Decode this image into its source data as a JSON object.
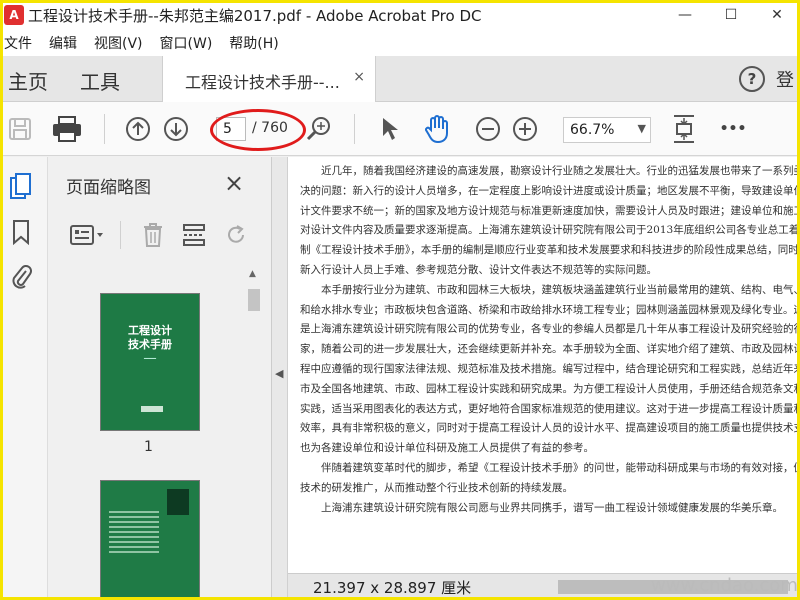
{
  "window": {
    "title": "工程设计技术手册--朱邦范主编2017.pdf - Adobe Acrobat Pro DC",
    "minimize": "—",
    "maximize": "☐",
    "close": "✕"
  },
  "menu": [
    "文件",
    "编辑",
    "视图(V)",
    "窗口(W)",
    "帮助(H)"
  ],
  "tabs": {
    "home": "主页",
    "tools": "工具",
    "document": "工程设计技术手册--...",
    "close": "×",
    "signin": "登"
  },
  "toolbar": {
    "page_current": "5",
    "page_total": "/ 760",
    "zoom": "66.7%",
    "more": "•••"
  },
  "panel": {
    "title": "页面缩略图",
    "close": "×",
    "thumb1_title": "工程设计\n技术手册",
    "thumb1_page": "1"
  },
  "document": {
    "paragraphs": [
      "近几年，随着我国经济建设的高速发展，勘察设计行业随之发展壮大。行业的迅猛发展也带来了一系列亟待解决的问题：新入行的设计人员增多，在一定程度上影响设计进度或设计质量；地区发展不平衡，导致建设单位对设计文件要求不统一；新的国家及地方设计规范与标准更新速度加快，需要设计人员及时跟进；建设单位和施工单位对设计文件内容及质量要求逐渐提高。上海浦东建筑设计研究院有限公司于2013年底组织公司各专业总工着手编制《工程设计技术手册》，本手册的编制是顺应行业变革和技术发展要求和科技进步的阶段性成果总结，同时解决新入行设计人员上手难、参考规范分散、设计文件表达不规范等的实际问题。",
      "本手册按行业分为建筑、市政和园林三大板块，建筑板块涵盖建筑行业当前最常用的建筑、结构、电气、暖通和给水排水专业；市政板块包含道路、桥梁和市政给排水环境工程专业；园林则涵盖园林景观及绿化专业。这些都是上海浦东建筑设计研究院有限公司的优势专业，各专业的参编人员都是几十年从事工程设计及研究经验的行业专家，随着公司的进一步发展壮大，还会继续更新并补充。本手册较为全面、详实地介绍了建筑、市政及园林设计过程中应遵循的现行国家法律法规、规范标准及技术措施。编写过程中，结合理论研究和工程实践，总结近年来上海市及全国各地建筑、市政、园林工程设计实践和研究成果。为方便工程设计人员使用，手册还结合规范条文和具体实践，适当采用图表化的表达方式，更好地符合国家标准规范的使用建议。这对于进一步提高工程设计质量和设计效率，具有非常积极的意义，同时对于提高工程设计人员的设计水平、提高建设项目的施工质量也提供技术支持，也为各建设单位和设计单位科研及施工人员提供了有益的参考。",
      "伴随着建筑变革时代的脚步，希望《工程设计技术手册》的问世，能带动科研成果与市场的有效对接，促进新技术的研发推广，从而推动整个行业技术创新的持续发展。",
      "上海浦东建筑设计研究院有限公司愿与业界共同携手，谱写一曲工程设计领域健康发展的华美乐章。"
    ]
  },
  "status": {
    "dimensions": "21.397 x 28.897 厘米"
  },
  "watermark": "www.cndao.com"
}
